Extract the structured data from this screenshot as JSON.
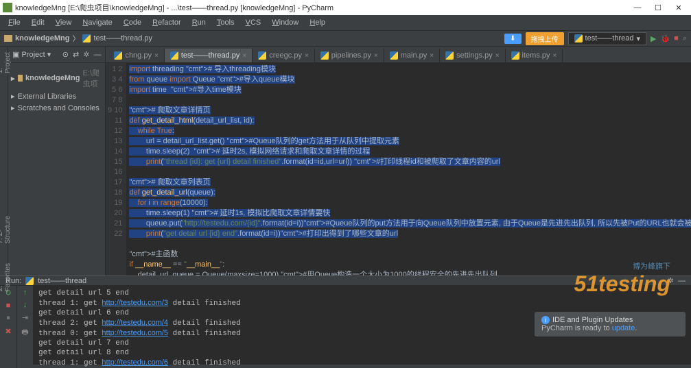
{
  "titlebar": {
    "title": "knowledgeMng [E:\\爬虫项目\\knowledgeMng] - ...\\test——thread.py [knowledgeMng] - PyCharm",
    "min": "—",
    "max": "☐",
    "close": "✕"
  },
  "menubar": [
    "File",
    "Edit",
    "View",
    "Navigate",
    "Code",
    "Refactor",
    "Run",
    "Tools",
    "VCS",
    "Window",
    "Help"
  ],
  "navbar": {
    "crumb1": "knowledgeMng",
    "crumb2": "test——thread.py",
    "blue_btn": "⬇",
    "orange_btn": "拖拽上传",
    "run_config": "test——thread",
    "dropdown": "▾"
  },
  "sidebar_labels": {
    "project": "1: Project",
    "structure": "7: Z- Structure",
    "favorites": "2: Favorites"
  },
  "project": {
    "header": "Project",
    "items": [
      {
        "label": "knowledgeMng",
        "suffix": " E:\\爬虫项"
      },
      {
        "label": "External Libraries"
      },
      {
        "label": "Scratches and Consoles"
      }
    ]
  },
  "tabs": [
    {
      "label": "chng.py"
    },
    {
      "label": "test——thread.py",
      "active": true
    },
    {
      "label": "creegc.py"
    },
    {
      "label": "pipelines.py"
    },
    {
      "label": "main.py"
    },
    {
      "label": "settings.py"
    },
    {
      "label": "items.py"
    }
  ],
  "gutter_start": 1,
  "gutter_end": 22,
  "code_lines": [
    "import threading # 导入threading模块",
    "from queue import Queue #导入queue模块",
    "import time  #导入time模块",
    "",
    "# 爬取文章详情页",
    "def get_detail_html(detail_url_list, id):",
    "    while True:",
    "        url = detail_url_list.get() #Queue队列的get方法用于从队列中提取元素",
    "        time.sleep(2)  # 延时2s, 模拟网络请求和爬取文章详情的过程",
    "        print(\"thread {id}: get {url} detail finished\".format(id=id,url=url)) #打印线程id和被爬取了文章内容的url",
    "",
    "# 爬取文章列表页",
    "def get_detail_url(queue):",
    "    for i in range(10000):",
    "        time.sleep(1) # 延时1s, 模拟比爬取文章详情要快",
    "        queue.put(\"http://testedu.com/{id}\".format(id=i))#Queue队列的put方法用于向Queue队列中放置元素, 由于Queue是先进先出队列, 所以先被Put的URL也就会被先get出来.",
    "        print(\"get detail url {id} end\".format(id=i))#打印出得到了哪些文章的url",
    "",
    "#主函数",
    "if __name__ == \"__main__\":",
    "    detail_url_queue = Queue(maxsize=1000) #用Queue构造一个大小为1000的线程安全的先进先出队列",
    ""
  ],
  "run": {
    "label": "Run:",
    "name": "test——thread"
  },
  "console": [
    "get detail url 5 end",
    "thread 1: get http://testedu.com/3 detail finished",
    "get detail url 6 end",
    "thread 2: get http://testedu.com/4 detail finished",
    "thread 0: get http://testedu.com/5 detail finished",
    "get detail url 7 end",
    "get detail url 8 end",
    "thread 1: get http://testedu.com/6 detail finished"
  ],
  "watermark": {
    "top": "博为峰旗下",
    "logo": "51testing"
  },
  "notification": {
    "title": "IDE and Plugin Updates",
    "body_prefix": "PyCharm is ready to ",
    "link": "update",
    "suffix": "."
  }
}
